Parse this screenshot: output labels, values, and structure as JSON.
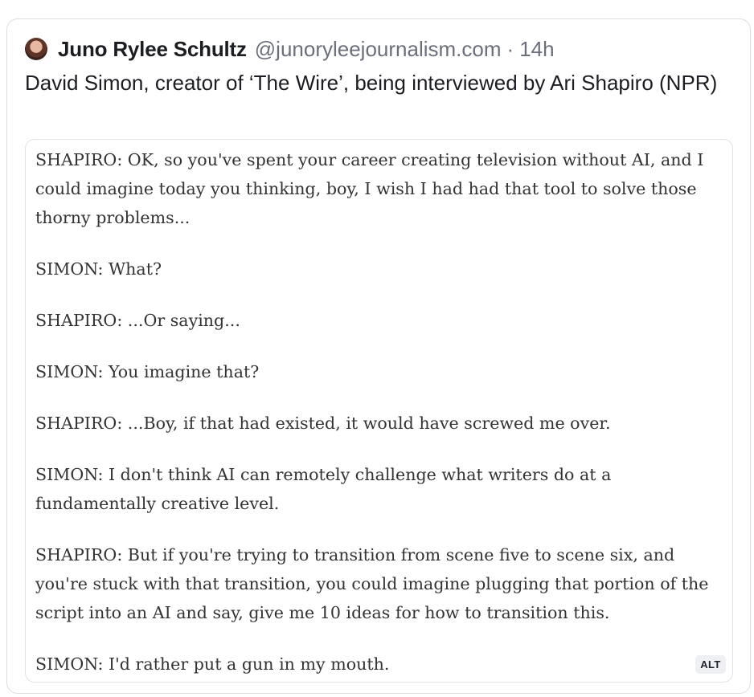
{
  "post": {
    "author_name": "Juno Rylee Schultz",
    "handle": "@junoryleejournalism.com",
    "separator": "·",
    "time": "14h",
    "text": "David Simon, creator of ‘The Wire’, being interviewed by Ari Shapiro (NPR)"
  },
  "image": {
    "alt_badge": "ALT",
    "paragraphs": [
      "SHAPIRO: OK, so you've spent your career creating television without AI, and I could imagine today you thinking, boy, I wish I had had that tool to solve those thorny problems...",
      "SIMON: What?",
      "SHAPIRO: ...Or saying...",
      "SIMON: You imagine that?",
      "SHAPIRO: ...Boy, if that had existed, it would have screwed me over.",
      "SIMON: I don't think AI can remotely challenge what writers do at a fundamentally creative level.",
      "SHAPIRO: But if you're trying to transition from scene five to scene six, and you're stuck with that transition, you could imagine plugging that portion of the script into an AI and say, give me 10 ideas for how to transition this.",
      "SIMON: I'd rather put a gun in my mouth."
    ]
  },
  "colors": {
    "text": "#1b1d22",
    "muted": "#6b6f7c",
    "border": "#dcdde3",
    "transcript_text": "#333333"
  }
}
